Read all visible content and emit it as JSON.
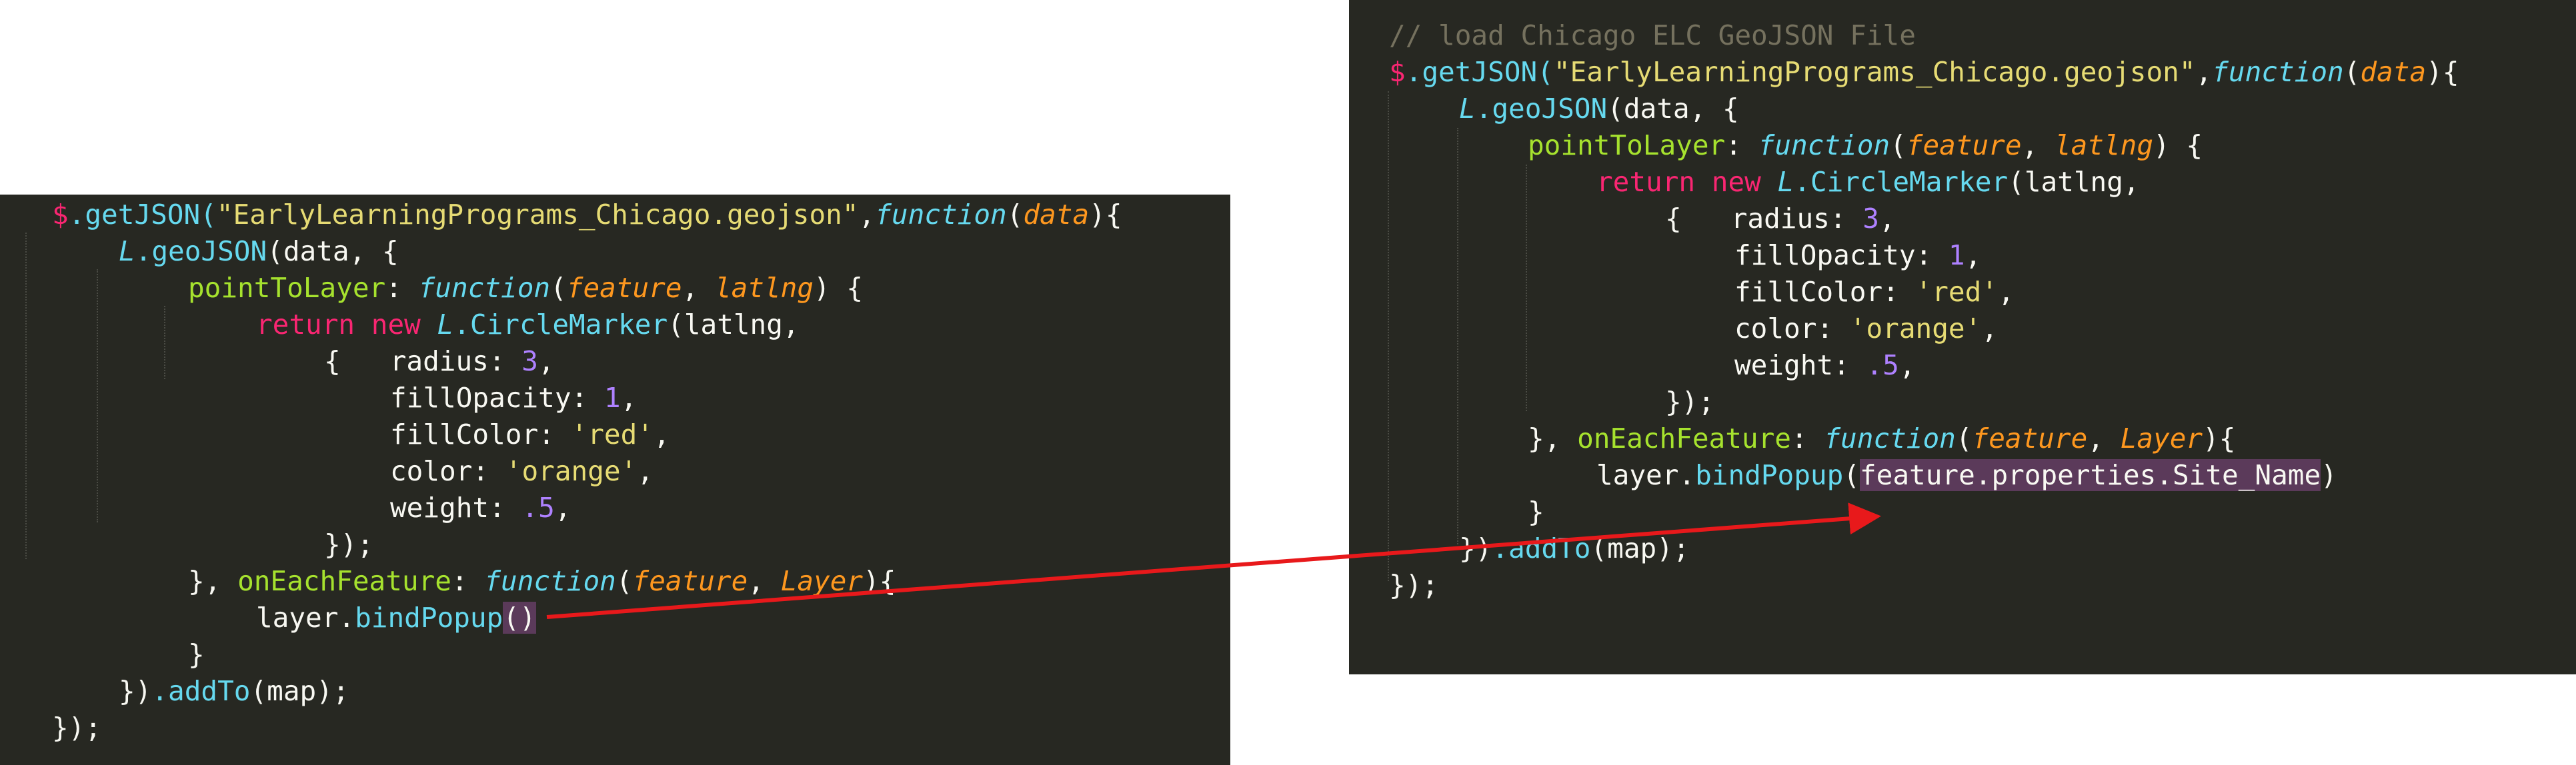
{
  "left_editor": {
    "lines": {
      "l1": {
        "dollar": "$",
        "call": ".getJSON(",
        "file": "\"EarlyLearningPrograms_Chicago.geojson\"",
        "comma": ",",
        "kw": "function",
        "open": "(",
        "param": "data",
        "close": "){"
      },
      "l2": {
        "obj": "L",
        "call": ".geoJSON",
        "rest": "(data, {"
      },
      "l3": {
        "prop": "pointToLayer",
        "colon": ": ",
        "kw": "function",
        "open": "(",
        "p1": "feature",
        "sep": ", ",
        "p2": "latlng",
        "close": ") {"
      },
      "l4": {
        "ret": "return",
        "sp": " ",
        "newkw": "new",
        "sp2": " ",
        "obj": "L",
        "cls": ".CircleMarker",
        "rest": "(latlng,"
      },
      "l5": {
        "brace": "{   ",
        "key": "radius: ",
        "num": "3",
        "tail": ","
      },
      "l6": {
        "key": "fillOpacity: ",
        "num": "1",
        "tail": ","
      },
      "l7": {
        "key": "fillColor: ",
        "str": "'red'",
        "tail": ","
      },
      "l8": {
        "key": "color: ",
        "str": "'orange'",
        "tail": ","
      },
      "l9": {
        "key": "weight: ",
        "num": ".5",
        "tail": ","
      },
      "l10": {
        "text": "});"
      },
      "l11": {
        "pre": "}, ",
        "prop": "onEachFeature",
        "colon": ": ",
        "kw": "function",
        "open": "(",
        "p1": "feature",
        "sep": ", ",
        "p2": "Layer",
        "close": "){"
      },
      "l12": {
        "obj": "layer.",
        "meth": "bindPopup",
        "paren": "()"
      },
      "l13": {
        "text": "}"
      },
      "l14": {
        "pre": "})",
        "meth": ".addTo",
        "rest": "(map);"
      },
      "l15": {
        "text": "});"
      }
    }
  },
  "right_editor": {
    "comment": "// load Chicago ELC GeoJSON File",
    "lines": {
      "l1": {
        "dollar": "$",
        "call": ".getJSON(",
        "file": "\"EarlyLearningPrograms_Chicago.geojson\"",
        "comma": ",",
        "kw": "function",
        "open": "(",
        "param": "data",
        "close": "){"
      },
      "l2": {
        "obj": "L",
        "call": ".geoJSON",
        "rest": "(data, {"
      },
      "l3": {
        "prop": "pointToLayer",
        "colon": ": ",
        "kw": "function",
        "open": "(",
        "p1": "feature",
        "sep": ", ",
        "p2": "latlng",
        "close": ") {"
      },
      "l4": {
        "ret": "return",
        "sp": " ",
        "newkw": "new",
        "sp2": " ",
        "obj": "L",
        "cls": ".CircleMarker",
        "rest": "(latlng,"
      },
      "l5": {
        "brace": "{   ",
        "key": "radius: ",
        "num": "3",
        "tail": ","
      },
      "l6": {
        "key": "fillOpacity: ",
        "num": "1",
        "tail": ","
      },
      "l7": {
        "key": "fillColor: ",
        "str": "'red'",
        "tail": ","
      },
      "l8": {
        "key": "color: ",
        "str": "'orange'",
        "tail": ","
      },
      "l9": {
        "key": "weight: ",
        "num": ".5",
        "tail": ","
      },
      "l10": {
        "text": "});"
      },
      "l11": {
        "pre": "}, ",
        "prop": "onEachFeature",
        "colon": ": ",
        "kw": "function",
        "open": "(",
        "p1": "feature",
        "sep": ", ",
        "p2": "Layer",
        "close": "){"
      },
      "l12": {
        "obj": "layer.",
        "meth": "bindPopup",
        "lp": "(",
        "arg": "feature.properties.Site_Name",
        "rp": ")"
      },
      "l13": {
        "text": "}"
      },
      "l14": {
        "pre": "})",
        "meth": ".addTo",
        "rest": "(map);"
      },
      "l15": {
        "text": "});"
      }
    }
  },
  "annotation": {
    "arrow_color": "#e8191b"
  }
}
